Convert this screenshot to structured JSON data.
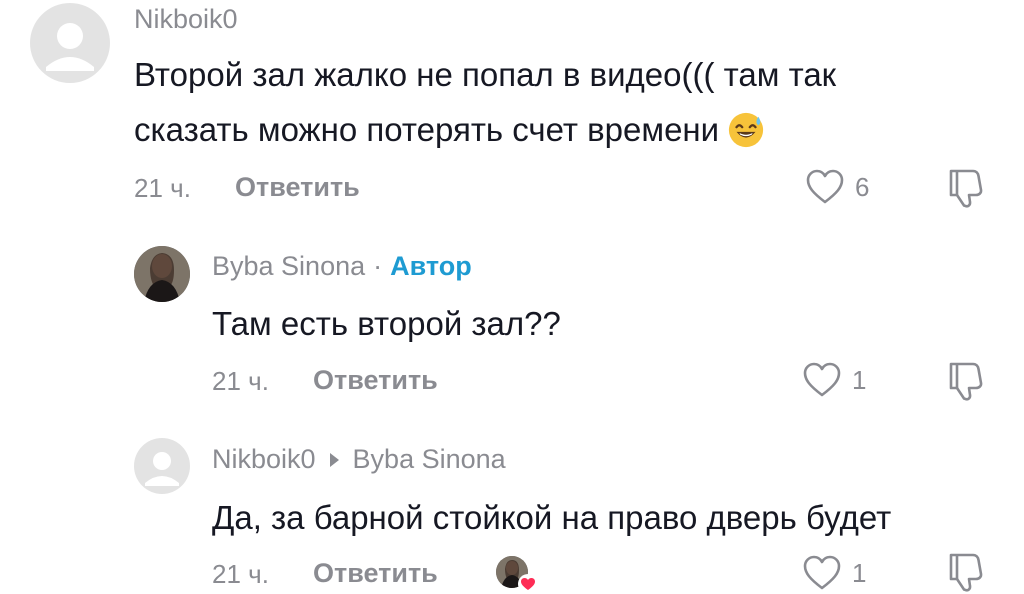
{
  "comments": [
    {
      "username": "Nikboik0",
      "text_line1": "Второй зал жалко не попал в видео((( там так",
      "text_line2": "сказать можно потерять счет времени",
      "emoji": "sweat-smile-emoji",
      "time": "21 ч.",
      "reply_label": "Ответить",
      "likes": "6"
    },
    {
      "username": "Byba Sinona",
      "separator": "·",
      "author_badge": "Автор",
      "text": "Там есть второй зал??",
      "time": "21 ч.",
      "reply_label": "Ответить",
      "likes": "1"
    },
    {
      "username": "Nikboik0",
      "reply_to": "Byba Sinona",
      "text": "Да, за барной стойкой на право дверь будет",
      "time": "21 ч.",
      "reply_label": "Ответить",
      "likes": "1",
      "liked_by_creator": true
    }
  ],
  "colors": {
    "text": "#161823",
    "secondary": "#8a8b91",
    "author_badge": "#1e9bd2",
    "heart": "#fe2c55"
  },
  "icons": [
    "default-avatar-icon",
    "heart-outline-icon",
    "dislike-icon",
    "heart-filled-icon"
  ]
}
